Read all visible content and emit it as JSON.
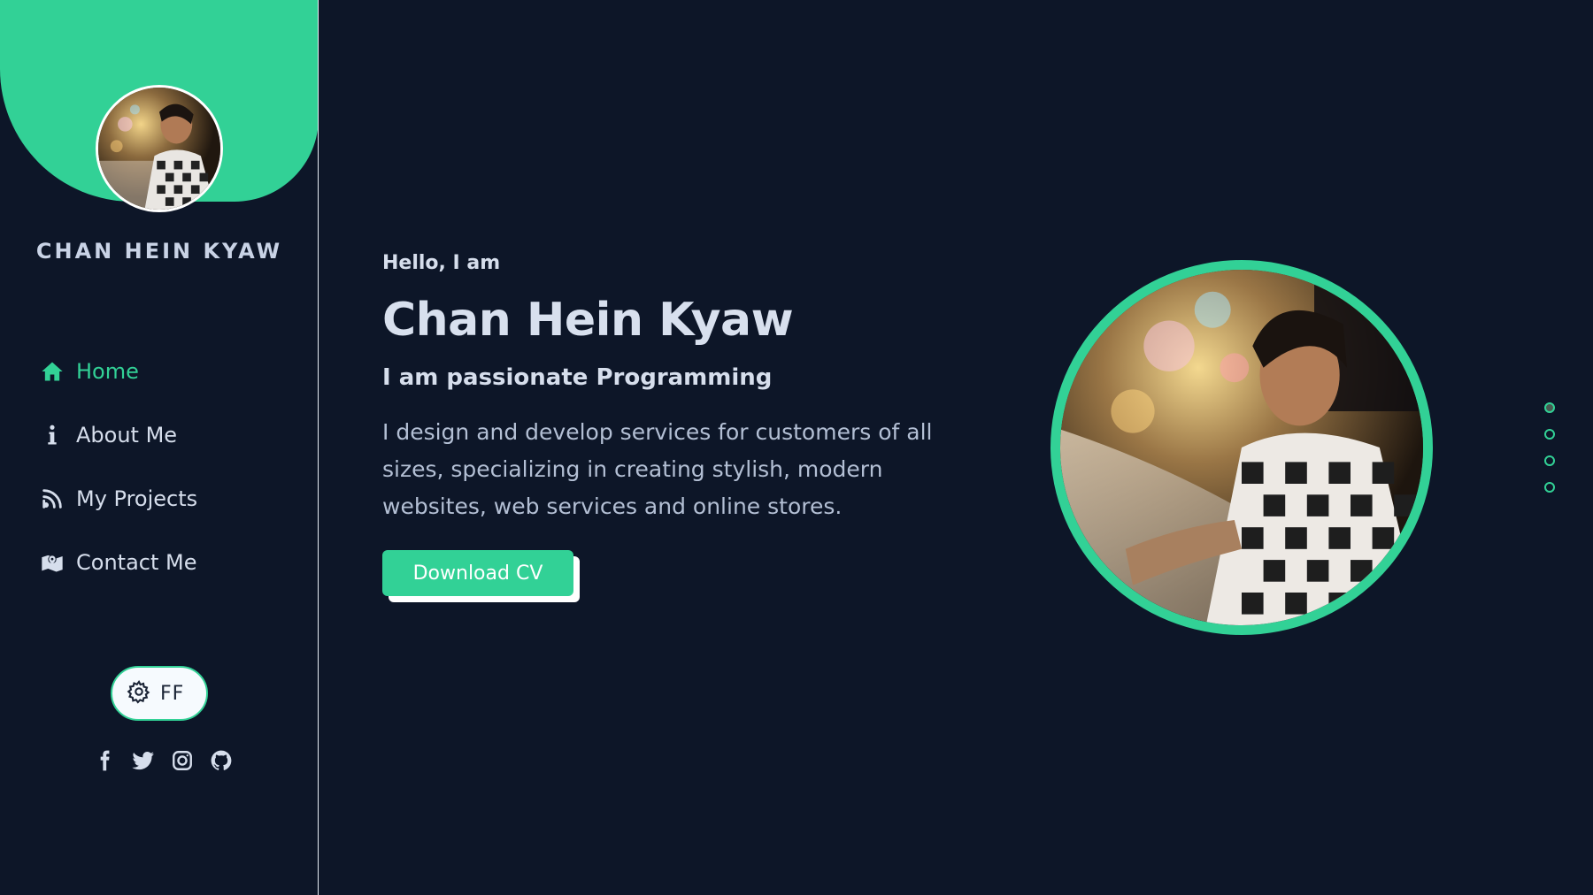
{
  "sidebar": {
    "name": "CHAN HEIN KYAW",
    "nav": [
      {
        "label": "Home",
        "icon": "home-icon",
        "active": true
      },
      {
        "label": "About Me",
        "icon": "info-icon",
        "active": false
      },
      {
        "label": "My Projects",
        "icon": "blog-icon",
        "active": false
      },
      {
        "label": "Contact Me",
        "icon": "map-icon",
        "active": false
      }
    ],
    "theme_toggle_label": "FF",
    "socials": [
      "facebook-icon",
      "twitter-icon",
      "instagram-icon",
      "github-icon"
    ]
  },
  "hero": {
    "greeting": "Hello, I am",
    "name": "Chan Hein Kyaw",
    "tagline": "I am passionate Programming",
    "description": "I design and develop services for customers of all sizes, specializing in creating stylish, modern websites, web services and online stores.",
    "cta_label": "Download CV"
  },
  "pagination": {
    "count": 4,
    "active_index": 0
  },
  "colors": {
    "accent": "#32d196",
    "background": "#0d1628",
    "text": "#d6deec"
  }
}
